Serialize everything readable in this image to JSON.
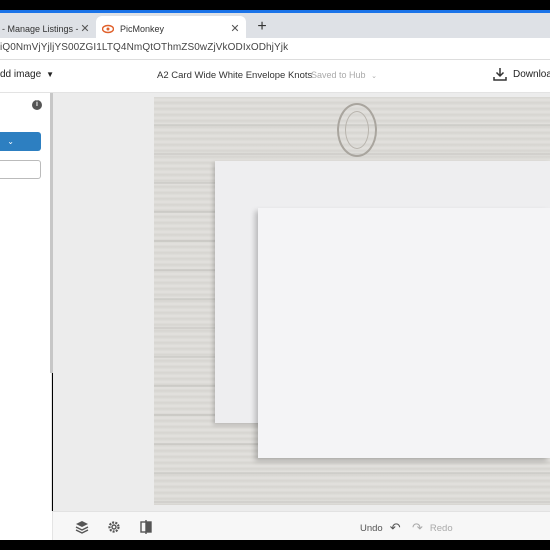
{
  "browser": {
    "tabs": [
      {
        "title": "- Manage Listings - Et",
        "active": false
      },
      {
        "title": "PicMonkey",
        "active": true
      }
    ],
    "url": "iQ0NmVjYjljYS00ZGI1LTQ4NmQtOThmZS0wZjVkODIxODhjYjk",
    "accent_color": "#1a73e8"
  },
  "header": {
    "add_image_label": "dd image",
    "doc_title": "A2 Card Wide White Envelope Knots",
    "saved_status": "Saved to Hub",
    "download_label": "Download"
  },
  "left_panel": {
    "info_icon": "info-icon",
    "primary_color": "#2d7fc1"
  },
  "bottom_bar": {
    "undo_label": "Undo",
    "redo_label": "Redo"
  }
}
